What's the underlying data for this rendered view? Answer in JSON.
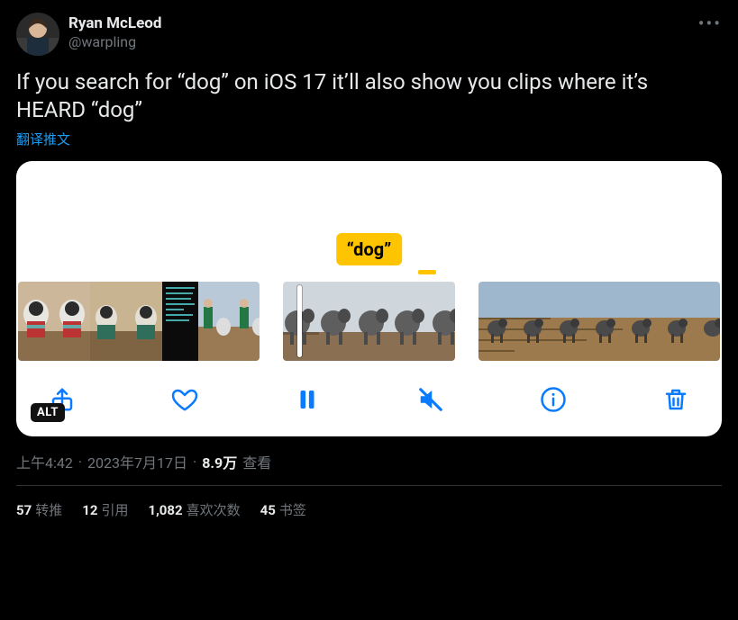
{
  "tweet": {
    "author": {
      "display_name": "Ryan McLeod",
      "handle": "@warpling"
    },
    "text": "If you search for “dog” on iOS 17 it’ll also show you clips where it’s HEARD “dog”",
    "translate_label": "翻译推文",
    "more_label": "•••",
    "media": {
      "search_chip": "“dog”",
      "alt_badge": "ALT",
      "toolbar": {
        "share": "share",
        "like": "like",
        "pause": "pause",
        "mute": "mute",
        "info": "info",
        "delete": "delete"
      }
    },
    "meta": {
      "time": "上午4:42",
      "date": "2023年7月17日",
      "views_n": "8.9万",
      "views_label": "查看"
    },
    "stats": {
      "retweets_n": "57",
      "retweets_label": "转推",
      "quotes_n": "12",
      "quotes_label": "引用",
      "likes_n": "1,082",
      "likes_label": "喜欢次数",
      "bookmarks_n": "45",
      "bookmarks_label": "书签"
    }
  }
}
